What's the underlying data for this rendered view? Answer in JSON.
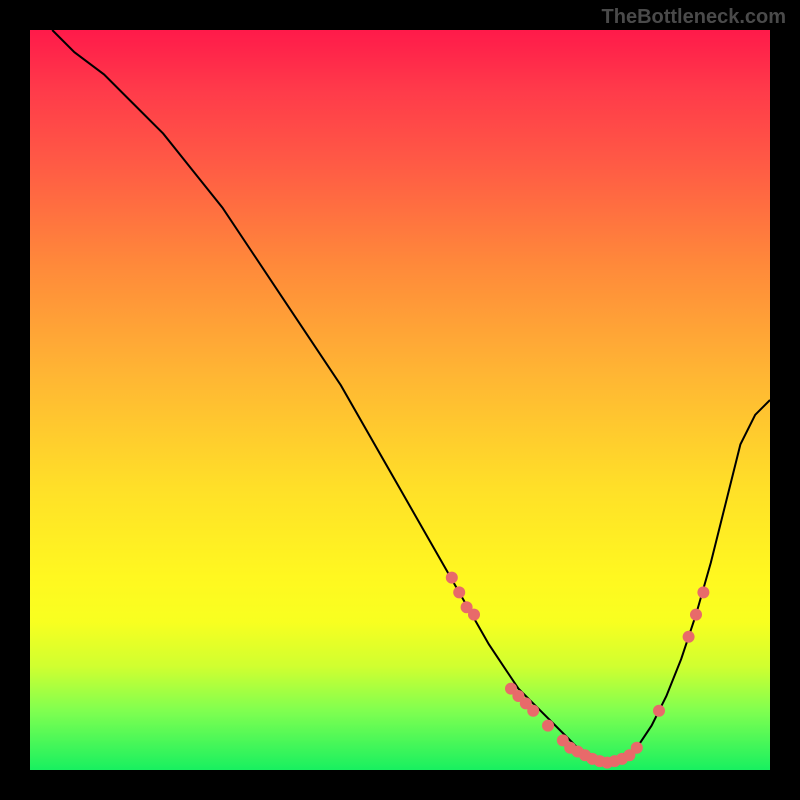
{
  "watermark": "TheBottleneck.com",
  "chart_data": {
    "type": "line",
    "title": "",
    "xlabel": "",
    "ylabel": "",
    "xlim": [
      0,
      100
    ],
    "ylim": [
      0,
      100
    ],
    "curve": {
      "name": "bottleneck-curve",
      "x": [
        3,
        6,
        10,
        14,
        18,
        22,
        26,
        30,
        34,
        38,
        42,
        46,
        50,
        54,
        58,
        62,
        64,
        66,
        68,
        70,
        72,
        74,
        76,
        78,
        80,
        82,
        84,
        86,
        88,
        90,
        92,
        94,
        96,
        98,
        100
      ],
      "y": [
        100,
        97,
        94,
        90,
        86,
        81,
        76,
        70,
        64,
        58,
        52,
        45,
        38,
        31,
        24,
        17,
        14,
        11,
        9,
        7,
        5,
        3,
        2,
        1,
        2,
        3,
        6,
        10,
        15,
        21,
        28,
        36,
        44,
        48,
        50
      ]
    },
    "markers": [
      {
        "x": 57,
        "y": 26
      },
      {
        "x": 58,
        "y": 24
      },
      {
        "x": 59,
        "y": 22
      },
      {
        "x": 60,
        "y": 21
      },
      {
        "x": 65,
        "y": 11
      },
      {
        "x": 66,
        "y": 10
      },
      {
        "x": 67,
        "y": 9
      },
      {
        "x": 68,
        "y": 8
      },
      {
        "x": 70,
        "y": 6
      },
      {
        "x": 72,
        "y": 4
      },
      {
        "x": 73,
        "y": 3
      },
      {
        "x": 74,
        "y": 2.5
      },
      {
        "x": 75,
        "y": 2
      },
      {
        "x": 76,
        "y": 1.5
      },
      {
        "x": 77,
        "y": 1.2
      },
      {
        "x": 78,
        "y": 1
      },
      {
        "x": 79,
        "y": 1.2
      },
      {
        "x": 80,
        "y": 1.5
      },
      {
        "x": 81,
        "y": 2
      },
      {
        "x": 82,
        "y": 3
      },
      {
        "x": 85,
        "y": 8
      },
      {
        "x": 89,
        "y": 18
      },
      {
        "x": 90,
        "y": 21
      },
      {
        "x": 91,
        "y": 24
      }
    ]
  }
}
